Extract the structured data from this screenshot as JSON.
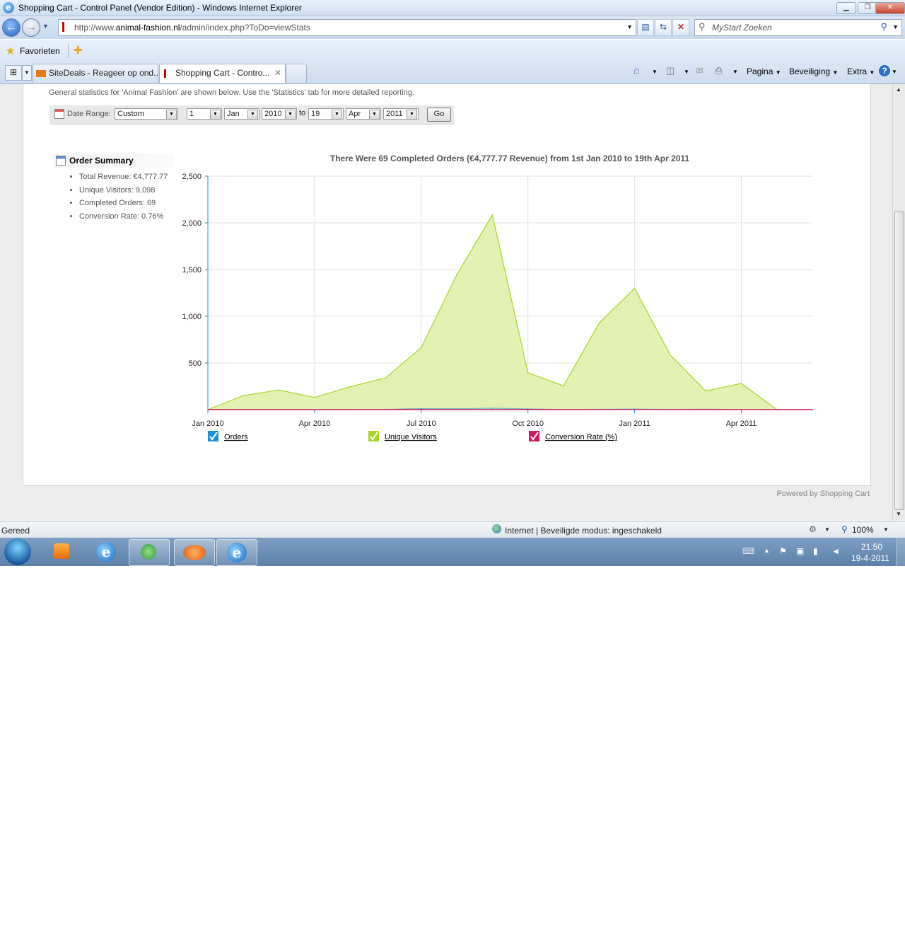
{
  "window": {
    "title": "Shopping Cart - Control Panel (Vendor Edition) - Windows Internet Explorer"
  },
  "nav": {
    "address_prefix": "http://www.",
    "address_domain": "animal-fashion.nl",
    "address_path": "/admin/index.php?ToDo=viewStats",
    "search_placeholder": "MyStart Zoeken"
  },
  "favorites": {
    "label": "Favorieten"
  },
  "tabs": [
    {
      "label": "SiteDeals - Reageer op ond..."
    },
    {
      "label": "Shopping Cart - Contro..."
    }
  ],
  "commandbar": {
    "page": "Pagina",
    "security": "Beveiliging",
    "extra": "Extra"
  },
  "page": {
    "intro": "General statistics for 'Animal Fashion' are shown below. Use the 'Statistics' tab for more detailed reporting.",
    "date_range_label": "Date Range:",
    "date_range_value": "Custom",
    "from_day": "1",
    "from_month": "Jan",
    "from_year": "2010",
    "to_label": "to",
    "to_day": "19",
    "to_month": "Apr",
    "to_year": "2011",
    "go_label": "Go",
    "summary_title": "Order Summary",
    "summary_items": [
      "Total Revenue: €4,777.77",
      "Unique Visitors: 9,098",
      "Completed Orders: 69",
      "Conversion Rate: 0.76%"
    ],
    "powered_by": "Powered by Shopping Cart"
  },
  "chart_data": {
    "type": "area",
    "title": "There Were 69 Completed Orders (€4,777.77 Revenue) from 1st Jan 2010 to 19th Apr 2011",
    "x_tick_labels": [
      "Jan 2010",
      "Apr 2010",
      "Jul 2010",
      "Oct 2010",
      "Jan 2011",
      "Apr 2011"
    ],
    "y_ticks": [
      500,
      1000,
      1500,
      2000,
      2500
    ],
    "y_tick_labels": [
      "500",
      "1,000",
      "1,500",
      "2,000",
      "2,500"
    ],
    "ylim": [
      0,
      2500
    ],
    "grid": true,
    "legend_position": "bottom",
    "x": [
      "Jan 2010",
      "Feb 2010",
      "Mar 2010",
      "Apr 2010",
      "May 2010",
      "Jun 2010",
      "Jul 2010",
      "Aug 2010",
      "Sep 2010",
      "Oct 2010",
      "Nov 2010",
      "Dec 2010",
      "Jan 2011",
      "Feb 2011",
      "Mar 2011",
      "Apr 2011",
      "May 2011",
      "Jun 2011"
    ],
    "series": [
      {
        "name": "Orders",
        "color": "#1e90d6",
        "values": [
          0,
          0,
          0,
          0,
          0,
          3,
          12,
          10,
          15,
          8,
          2,
          4,
          6,
          3,
          5,
          1,
          0,
          0
        ]
      },
      {
        "name": "Unique Visitors",
        "color": "#a8d42a",
        "values": [
          0,
          150,
          210,
          130,
          245,
          340,
          665,
          1445,
          2085,
          395,
          255,
          925,
          1300,
          585,
          200,
          280,
          0,
          0
        ]
      },
      {
        "name": "Conversion Rate (%)",
        "color": "#d8145a",
        "values": [
          0,
          0,
          0,
          0,
          0,
          0.9,
          1.8,
          0.7,
          0.7,
          2.0,
          0.8,
          0.4,
          0.5,
          0.5,
          2.5,
          0.4,
          0,
          0
        ]
      }
    ]
  },
  "status": {
    "text": "Gereed",
    "zone": "Internet | Beveiligde modus: ingeschakeld",
    "zoom": "100%"
  },
  "taskbar": {
    "time": "21:50",
    "date": "19-4-2011"
  }
}
